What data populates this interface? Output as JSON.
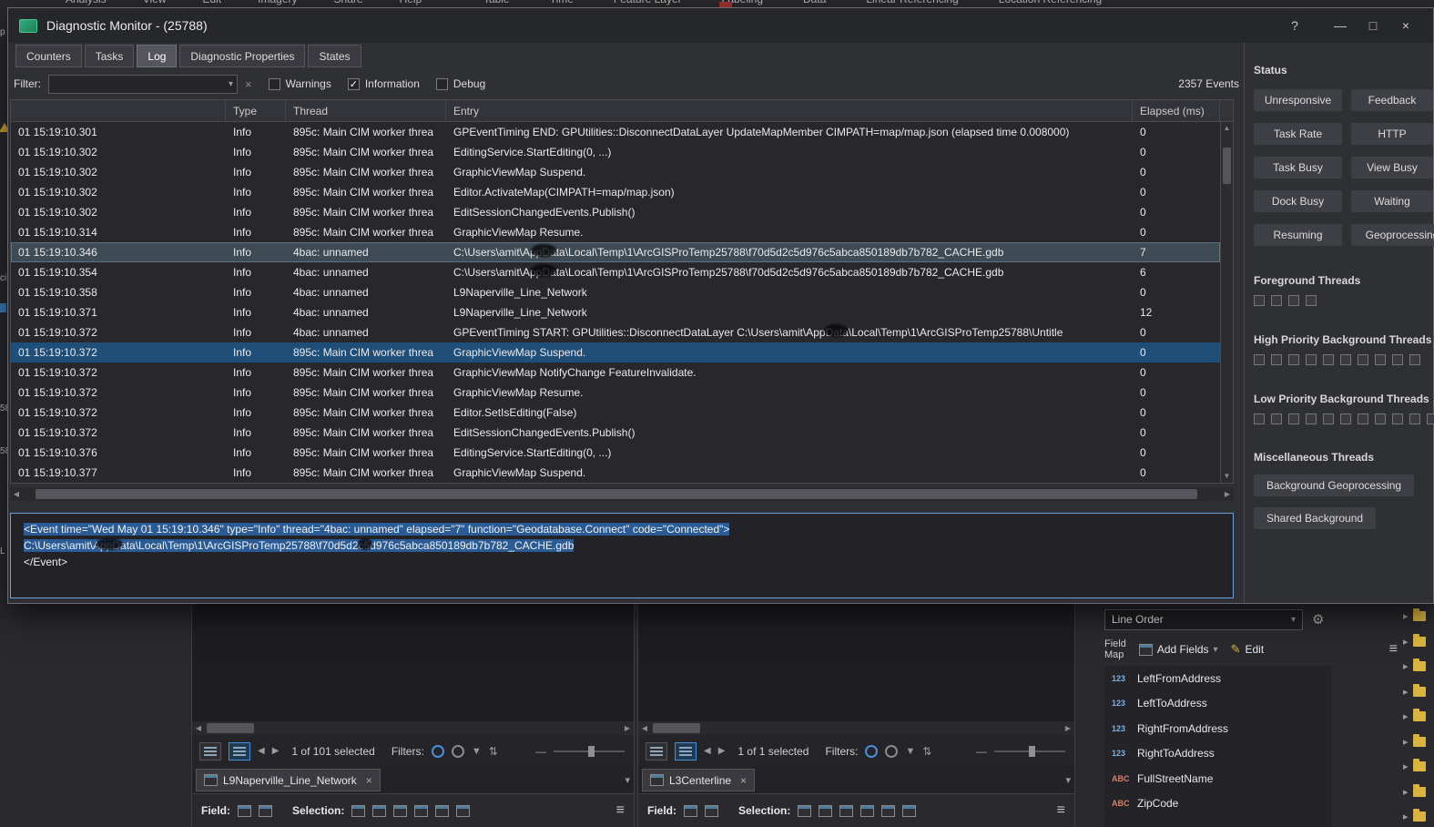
{
  "ribbon": {
    "left_tabs": [
      "Analysis",
      "View",
      "Edit",
      "Imagery",
      "Share",
      "Help"
    ],
    "right_tabs": [
      "Table",
      "Time",
      "Feature Layer",
      "Labeling",
      "Data",
      "Linear Referencing",
      "Location Referencing"
    ]
  },
  "left_edge_fragments": [
    "p",
    "ci",
    "58",
    "58",
    "L"
  ],
  "dialog": {
    "title": "Diagnostic Monitor - (25788)",
    "window_buttons": {
      "help": "?",
      "minimize": "—",
      "maximize": "□",
      "close": "×"
    },
    "tabs": {
      "counters": "Counters",
      "tasks": "Tasks",
      "log": "Log",
      "diagnostic_properties": "Diagnostic Properties",
      "states": "States"
    },
    "filter": {
      "label": "Filter:",
      "clear": "×",
      "warnings": "Warnings",
      "information": "Information",
      "debug": "Debug",
      "events": "2357 Events"
    },
    "log": {
      "columns": {
        "time": "",
        "type": "Type",
        "thread": "Thread",
        "entry": "Entry",
        "elapsed": "Elapsed (ms)"
      },
      "rows": [
        {
          "time": "01 15:19:10.301",
          "type": "Info",
          "thread": "895c: Main CIM worker threa",
          "entry": "GPEventTiming END: GPUtilities::DisconnectDataLayer UpdateMapMember CIMPATH=map/map.json (elapsed time 0.008000)",
          "elapsed": "0",
          "state": ""
        },
        {
          "time": "01 15:19:10.302",
          "type": "Info",
          "thread": "895c: Main CIM worker threa",
          "entry": "EditingService.StartEditing(0, ...)",
          "elapsed": "0",
          "state": ""
        },
        {
          "time": "01 15:19:10.302",
          "type": "Info",
          "thread": "895c: Main CIM worker threa",
          "entry": "GraphicViewMap Suspend.",
          "elapsed": "0",
          "state": ""
        },
        {
          "time": "01 15:19:10.302",
          "type": "Info",
          "thread": "895c: Main CIM worker threa",
          "entry": "Editor.ActivateMap(CIMPATH=map/map.json)",
          "elapsed": "0",
          "state": ""
        },
        {
          "time": "01 15:19:10.302",
          "type": "Info",
          "thread": "895c: Main CIM worker threa",
          "entry": "EditSessionChangedEvents.Publish()",
          "elapsed": "0",
          "state": ""
        },
        {
          "time": "01 15:19:10.314",
          "type": "Info",
          "thread": "895c: Main CIM worker threa",
          "entry": "GraphicViewMap Resume.",
          "elapsed": "0",
          "state": ""
        },
        {
          "time": "01 15:19:10.346",
          "type": "Info",
          "thread": "4bac: unnamed",
          "entry": "C:\\Users\\amit\\AppData\\Local\\Temp\\1\\ArcGISProTemp25788\\f70d5d2c5d976c5abca850189db7b782_CACHE.gdb",
          "elapsed": "7",
          "state": "sel-gray"
        },
        {
          "time": "01 15:19:10.354",
          "type": "Info",
          "thread": "4bac: unnamed",
          "entry": "C:\\Users\\amit\\AppData\\Local\\Temp\\1\\ArcGISProTemp25788\\f70d5d2c5d976c5abca850189db7b782_CACHE.gdb",
          "elapsed": "6",
          "state": ""
        },
        {
          "time": "01 15:19:10.358",
          "type": "Info",
          "thread": "4bac: unnamed",
          "entry": "L9Naperville_Line_Network",
          "elapsed": "0",
          "state": ""
        },
        {
          "time": "01 15:19:10.371",
          "type": "Info",
          "thread": "4bac: unnamed",
          "entry": "L9Naperville_Line_Network",
          "elapsed": "12",
          "state": ""
        },
        {
          "time": "01 15:19:10.372",
          "type": "Info",
          "thread": "4bac: unnamed",
          "entry": "GPEventTiming START: GPUtilities::DisconnectDataLayer C:\\Users\\amit\\AppData\\Local\\Temp\\1\\ArcGISProTemp25788\\Untitle",
          "elapsed": "0",
          "state": ""
        },
        {
          "time": "01 15:19:10.372",
          "type": "Info",
          "thread": "895c: Main CIM worker threa",
          "entry": "GraphicViewMap Suspend.",
          "elapsed": "0",
          "state": "sel-blue"
        },
        {
          "time": "01 15:19:10.372",
          "type": "Info",
          "thread": "895c: Main CIM worker threa",
          "entry": "GraphicViewMap NotifyChange FeatureInvalidate.",
          "elapsed": "0",
          "state": ""
        },
        {
          "time": "01 15:19:10.372",
          "type": "Info",
          "thread": "895c: Main CIM worker threa",
          "entry": "GraphicViewMap Resume.",
          "elapsed": "0",
          "state": ""
        },
        {
          "time": "01 15:19:10.372",
          "type": "Info",
          "thread": "895c: Main CIM worker threa",
          "entry": "Editor.SetIsEditing(False)",
          "elapsed": "0",
          "state": ""
        },
        {
          "time": "01 15:19:10.372",
          "type": "Info",
          "thread": "895c: Main CIM worker threa",
          "entry": "EditSessionChangedEvents.Publish()",
          "elapsed": "0",
          "state": ""
        },
        {
          "time": "01 15:19:10.376",
          "type": "Info",
          "thread": "895c: Main CIM worker threa",
          "entry": "EditingService.StartEditing(0, ...)",
          "elapsed": "0",
          "state": ""
        },
        {
          "time": "01 15:19:10.377",
          "type": "Info",
          "thread": "895c: Main CIM worker threa",
          "entry": "GraphicViewMap Suspend.",
          "elapsed": "0",
          "state": ""
        }
      ]
    },
    "detail": {
      "selected_lines": [
        "<Event time=\"Wed May 01 15:19:10.346\" type=\"Info\" thread=\"4bac: unnamed\" elapsed=\"7\" function=\"Geodatabase.Connect\" code=\"Connected\">",
        "C:\\Users\\amit\\AppData\\Local\\Temp\\1\\ArcGISProTemp25788\\f70d5d2c5d976c5abca850189db7b782_CACHE.gdb"
      ],
      "plain_lines": [
        "</Event>"
      ]
    },
    "status": {
      "title": "Status",
      "buttons": [
        "Unresponsive",
        "Feedback",
        "Task Rate",
        "HTTP",
        "Task Busy",
        "View Busy",
        "Dock Busy",
        "Waiting",
        "Resuming",
        "Geoprocessing"
      ],
      "thread_groups": [
        {
          "label": "Foreground Threads",
          "count": 4
        },
        {
          "label": "High Priority Background Threads",
          "count": 10
        },
        {
          "label": "Low Priority Background Threads",
          "count": 11
        }
      ],
      "misc_label": "Miscellaneous Threads",
      "misc_buttons": [
        "Background Geoprocessing",
        "Shared Background"
      ]
    }
  },
  "tables": [
    {
      "selected": "1 of 101 selected",
      "filters_label": "Filters:",
      "tab": "L9Naperville_Line_Network",
      "field_label": "Field:",
      "selection_label": "Selection:"
    },
    {
      "selected": "1 of 1 selected",
      "filters_label": "Filters:",
      "tab": "L3Centerline",
      "field_label": "Field:",
      "selection_label": "Selection:"
    }
  ],
  "field_panel": {
    "dropdown_value": "Line Order",
    "field_map_line1": "Field",
    "field_map_line2": "Map",
    "add_fields_label": "Add Fields",
    "edit_label": "Edit",
    "fields": [
      {
        "icon": "123",
        "name": "LeftFromAddress"
      },
      {
        "icon": "123",
        "name": "LeftToAddress"
      },
      {
        "icon": "123",
        "name": "RightFromAddress"
      },
      {
        "icon": "123",
        "name": "RightToAddress"
      },
      {
        "icon": "ABC",
        "name": "FullStreetName"
      },
      {
        "icon": "ABC",
        "name": "ZipCode"
      }
    ]
  }
}
